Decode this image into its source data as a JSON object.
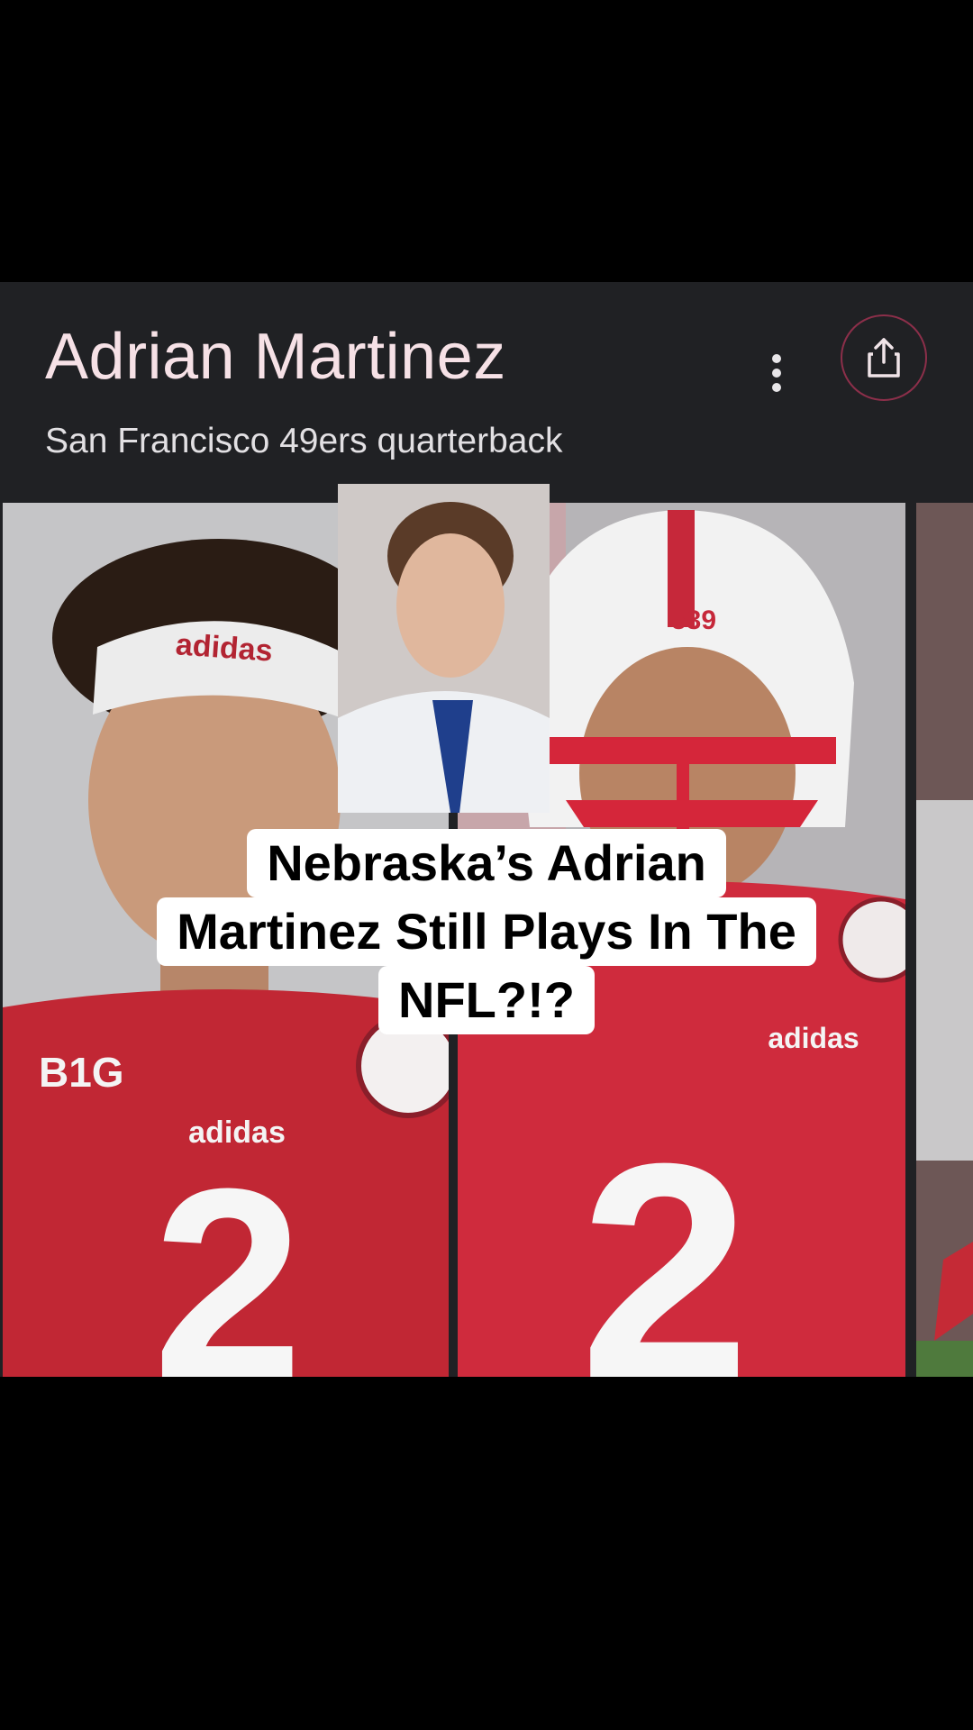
{
  "panel": {
    "title": "Adrian Martinez",
    "subtitle": "San Francisco 49ers quarterback"
  },
  "images": [
    {
      "description_icon": "player-photo-icon"
    },
    {
      "description_icon": "player-helmet-photo-icon"
    },
    {
      "description_icon": "player-action-photo-icon"
    }
  ],
  "overlay": {
    "lines": [
      "Nebraska’s Adrian",
      "Martinez Still Plays In The",
      "NFL?!?"
    ]
  },
  "colors": {
    "panel_bg": "#202124",
    "title": "#f6e1e6",
    "share_ring": "#8c2f4a",
    "jersey_red": "#c02834"
  }
}
